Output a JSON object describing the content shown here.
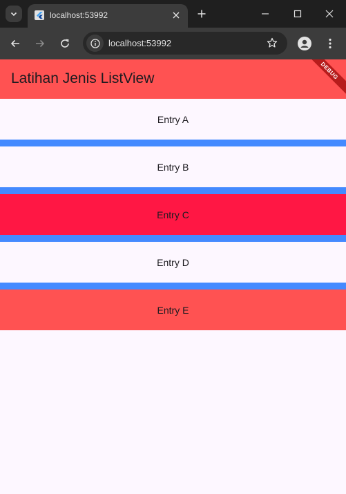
{
  "browser": {
    "tab": {
      "title": "localhost:53992"
    },
    "address": {
      "url": "localhost:53992"
    }
  },
  "app": {
    "title": "Latihan Jenis ListView",
    "debug_banner": "DEBUG",
    "colors": {
      "appbar": "#ff5252",
      "divider": "#448aff",
      "background": "#fdf7ff"
    },
    "entries": [
      {
        "label": "Entry A",
        "color": "#fdf7ff"
      },
      {
        "label": "Entry B",
        "color": "#fdf7ff"
      },
      {
        "label": "Entry C",
        "color": "#ff1744"
      },
      {
        "label": "Entry D",
        "color": "#fdf7ff"
      },
      {
        "label": "Entry E",
        "color": "#ff5252"
      }
    ]
  }
}
